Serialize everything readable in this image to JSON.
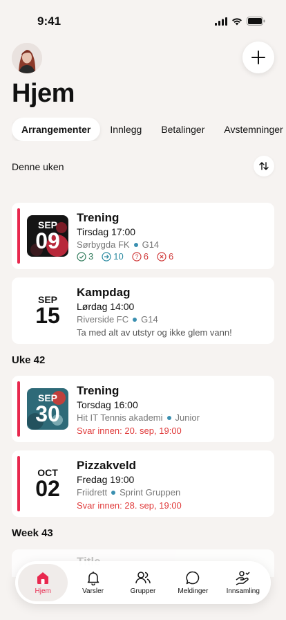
{
  "status": {
    "time": "9:41"
  },
  "header": {
    "title": "Hjem"
  },
  "tabs": [
    {
      "label": "Arrangementer",
      "active": true
    },
    {
      "label": "Innlegg"
    },
    {
      "label": "Betalinger"
    },
    {
      "label": "Avstemninger"
    }
  ],
  "sections": {
    "this_week": "Denne uken",
    "week42": "Uke 42",
    "week43": "Week 43"
  },
  "events": [
    {
      "month": "SEP",
      "day": "09",
      "title": "Trening",
      "when": "Tirsdag 17:00",
      "team": "Sørbygda FK",
      "group": "G14",
      "stats": {
        "yes": "3",
        "seen": "10",
        "unknown": "6",
        "no": "6"
      }
    },
    {
      "month": "SEP",
      "day": "15",
      "title": "Kampdag",
      "when": "Lørdag 14:00",
      "team": "Riverside FC",
      "group": "G14",
      "note": "Ta med alt av utstyr og ikke glem vann!"
    },
    {
      "month": "SEP",
      "day": "30",
      "title": "Trening",
      "when": "Torsdag 16:00",
      "team": "Hit IT Tennis akademi",
      "group": "Junior",
      "deadline": "Svar innen: 20. sep, 19:00"
    },
    {
      "month": "OCT",
      "day": "02",
      "title": "Pizzakveld",
      "when": "Fredag 19:00",
      "team": "Friidrett",
      "group": "Sprint Gruppen",
      "deadline": "Svar innen: 28. sep, 19:00"
    }
  ],
  "peek": {
    "title": "Title"
  },
  "nav": [
    {
      "label": "Hjem",
      "icon": "home-icon",
      "active": true
    },
    {
      "label": "Varsler",
      "icon": "bell-icon"
    },
    {
      "label": "Grupper",
      "icon": "people-icon"
    },
    {
      "label": "Meldinger",
      "icon": "chat-icon"
    },
    {
      "label": "Innsamling",
      "icon": "fundraising-icon"
    }
  ],
  "colors": {
    "accent": "#e8284e",
    "background": "#f6f3f1",
    "group_dot": "#3a8fb0",
    "deadline": "#e03a3a"
  }
}
